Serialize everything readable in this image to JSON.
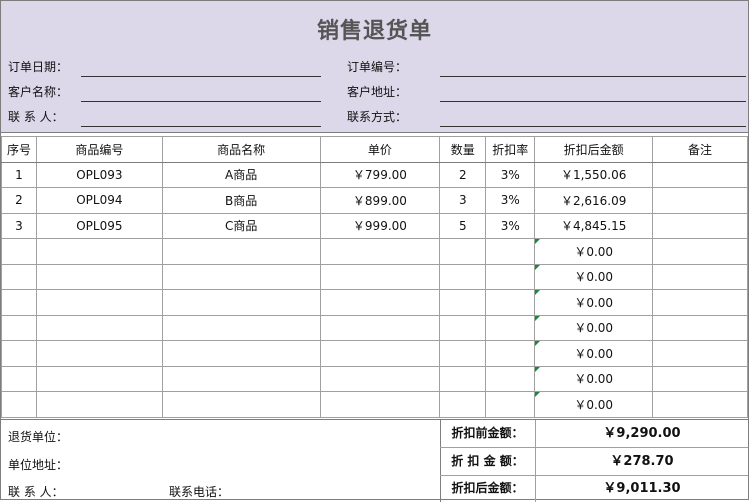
{
  "title": "销售退货单",
  "header": {
    "order_date": "订单日期：",
    "order_no": "订单编号：",
    "customer_name": "客户名称：",
    "customer_address": "客户地址：",
    "contact": "联 系 人：",
    "contact_method": "联系方式："
  },
  "table": {
    "columns": [
      "序号",
      "商品编号",
      "商品名称",
      "单价",
      "数量",
      "折扣率",
      "折扣后金额",
      "备注"
    ],
    "rows": [
      {
        "seq": "1",
        "code": "OPL093",
        "name": "A商品",
        "price": "￥799.00",
        "qty": "2",
        "rate": "3%",
        "amount": "￥1,550.06",
        "note": ""
      },
      {
        "seq": "2",
        "code": "OPL094",
        "name": "B商品",
        "price": "￥899.00",
        "qty": "3",
        "rate": "3%",
        "amount": "￥2,616.09",
        "note": ""
      },
      {
        "seq": "3",
        "code": "OPL095",
        "name": "C商品",
        "price": "￥999.00",
        "qty": "5",
        "rate": "3%",
        "amount": "￥4,845.15",
        "note": ""
      },
      {
        "seq": "",
        "code": "",
        "name": "",
        "price": "",
        "qty": "",
        "rate": "",
        "amount": "￥0.00",
        "note": ""
      },
      {
        "seq": "",
        "code": "",
        "name": "",
        "price": "",
        "qty": "",
        "rate": "",
        "amount": "￥0.00",
        "note": ""
      },
      {
        "seq": "",
        "code": "",
        "name": "",
        "price": "",
        "qty": "",
        "rate": "",
        "amount": "￥0.00",
        "note": ""
      },
      {
        "seq": "",
        "code": "",
        "name": "",
        "price": "",
        "qty": "",
        "rate": "",
        "amount": "￥0.00",
        "note": ""
      },
      {
        "seq": "",
        "code": "",
        "name": "",
        "price": "",
        "qty": "",
        "rate": "",
        "amount": "￥0.00",
        "note": ""
      },
      {
        "seq": "",
        "code": "",
        "name": "",
        "price": "",
        "qty": "",
        "rate": "",
        "amount": "￥0.00",
        "note": ""
      },
      {
        "seq": "",
        "code": "",
        "name": "",
        "price": "",
        "qty": "",
        "rate": "",
        "amount": "￥0.00",
        "note": ""
      }
    ]
  },
  "footer": {
    "return_unit": "退货单位：",
    "unit_address": "单位地址：",
    "contact": "联 系 人：",
    "phone": "联系电话：",
    "before_discount_label": "折扣前金额：",
    "before_discount_value": "￥9,290.00",
    "discount_label": "折 扣 金 额：",
    "discount_value": "￥278.70",
    "after_discount_label": "折扣后金额：",
    "after_discount_value": "￥9,011.30"
  },
  "colors": {
    "header_bg": "#dcd8ea",
    "marker": "#1a8a3a"
  }
}
